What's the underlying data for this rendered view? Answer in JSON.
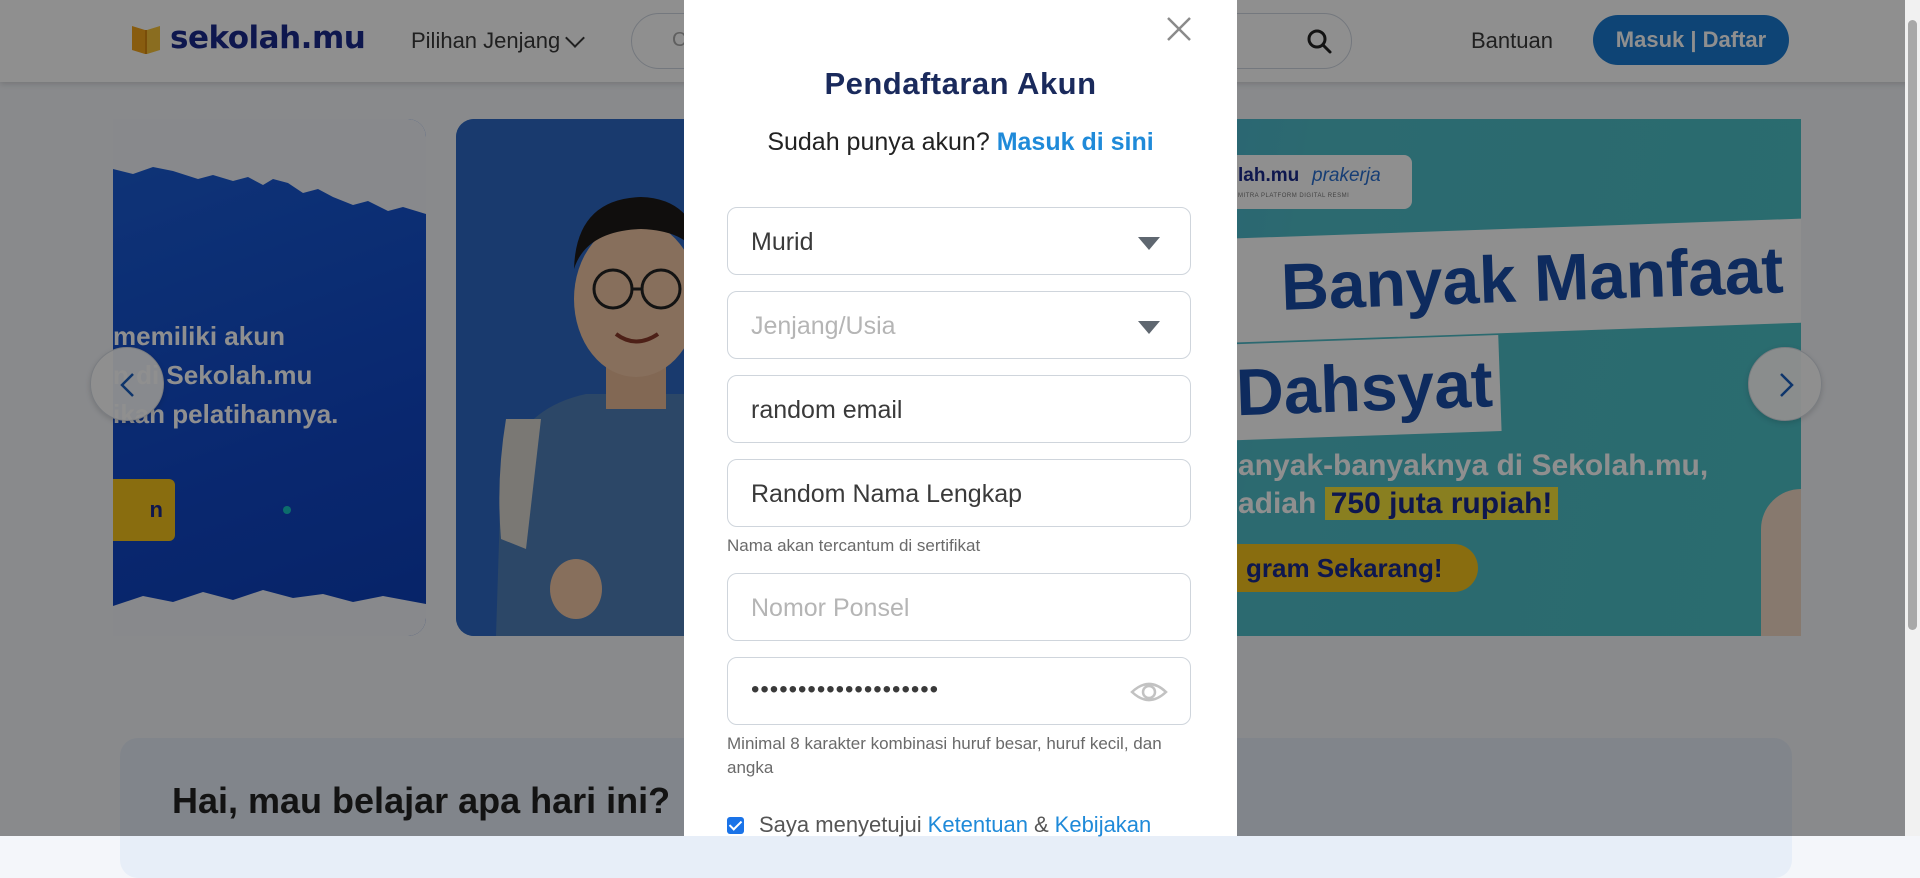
{
  "header": {
    "logo_text": "sekolah.mu",
    "nav_jenjang": "Pilihan Jenjang",
    "search_placeholder": "C",
    "help": "Bantuan",
    "login_button": "Masuk | Daftar"
  },
  "banner_left": {
    "lines": [
      "memiliki akun",
      "n di Sekolah.mu",
      "ikan pelatihannya."
    ],
    "cta": "n"
  },
  "banner_main": {
    "badge_brand": "lah.mu",
    "badge_partner": "prakerja",
    "badge_caption": "MITRA PLATFORM DIGITAL RESMI",
    "headline_1": "Banyak Manfaat",
    "headline_2": "Dahsyat",
    "sub_1": "anyak-banyaknya di Sekolah.mu,",
    "sub_2_prefix": "adiah ",
    "sub_2_highlight": "750 juta rupiah!",
    "cta": "gram Sekarang!"
  },
  "greeting": "Hai, mau belajar apa hari ini?",
  "modal": {
    "title": "Pendaftaran Akun",
    "subtitle_prefix": "Sudah punya akun?",
    "subtitle_link": "Masuk di sini",
    "role_value": "Murid",
    "level_placeholder": "Jenjang/Usia",
    "email_value": "random email",
    "name_value": "Random Nama Lengkap",
    "name_hint": "Nama akan tercantum di sertifikat",
    "phone_placeholder": "Nomor Ponsel",
    "password_mask": "••••••••••••••••••••",
    "password_hint": "Minimal 8 karakter kombinasi huruf besar, huruf kecil, dan angka",
    "agree_prefix": "Saya menyetujui",
    "agree_link_1": "Ketentuan",
    "agree_amp": "&",
    "agree_link_2": "Kebijakan",
    "agree_checked": true
  },
  "colors": {
    "brand_navy": "#1a2a8c",
    "primary_blue": "#1a7ad1",
    "link_blue": "#1f8ad9",
    "accent_yellow": "#f5c21b"
  },
  "icons": {
    "logo": "book-icon",
    "search": "search-icon",
    "close": "close-icon",
    "eye": "eye-icon",
    "prev": "chevron-left-icon",
    "next": "chevron-right-icon"
  }
}
